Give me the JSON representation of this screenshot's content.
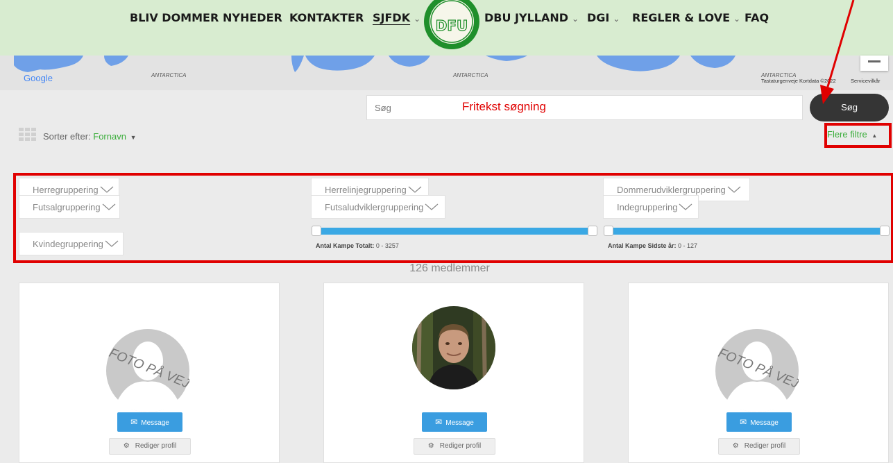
{
  "nav": {
    "items": [
      {
        "label": "BLIV DOMMER",
        "dropdown": false
      },
      {
        "label": "NYHEDER",
        "dropdown": false
      },
      {
        "label": "KONTAKTER",
        "dropdown": false
      },
      {
        "label": "SJFDK",
        "dropdown": true
      },
      {
        "label": "DBU JYLLAND",
        "dropdown": true
      },
      {
        "label": "DGI",
        "dropdown": true
      },
      {
        "label": "REGLER & LOVE",
        "dropdown": true
      },
      {
        "label": "FAQ",
        "dropdown": false
      }
    ],
    "logo_text": "DFU"
  },
  "map": {
    "google_label": "Google",
    "region_label": "ANTARCTICA",
    "shortcuts": "Tastaturgenveje",
    "mapdata": "Kortdata ©2022",
    "terms": "Servicevilkår"
  },
  "search": {
    "placeholder": "Søg",
    "button_label": "Søg",
    "annotation": "Fritekst søgning"
  },
  "sort": {
    "label": "Sorter efter:",
    "value": "Fornavn"
  },
  "filters_toggle": "Flere filtre",
  "filters": {
    "herre": "Herregruppering",
    "herrelinje": "Herrelinjegruppering",
    "dommerudvikler": "Dommerudviklergruppering",
    "futsal": "Futsalgruppering",
    "futsaludvikler": "Futsaludviklergruppering",
    "inde": "Indegruppering",
    "kvinde": "Kvindegruppering"
  },
  "sliders": {
    "total": {
      "label": "Antal Kampe Totalt:",
      "range": "0 - 3257",
      "min": 0,
      "max": 3257
    },
    "last_year": {
      "label": "Antal Kampe Sidste år:",
      "range": "0 - 127",
      "min": 0,
      "max": 127
    }
  },
  "member_count": "126 medlemmer",
  "cards": {
    "photo_placeholder": "FOTO PÅ VEJ",
    "message_label": "Message",
    "edit_label": "Rediger profil"
  },
  "colors": {
    "header_bg": "#d8ecd0",
    "accent_green": "#3aad3a",
    "slider_blue": "#3aa8e4",
    "message_blue": "#3a9de0",
    "annotation_red": "#e00000",
    "search_button": "#353535"
  }
}
